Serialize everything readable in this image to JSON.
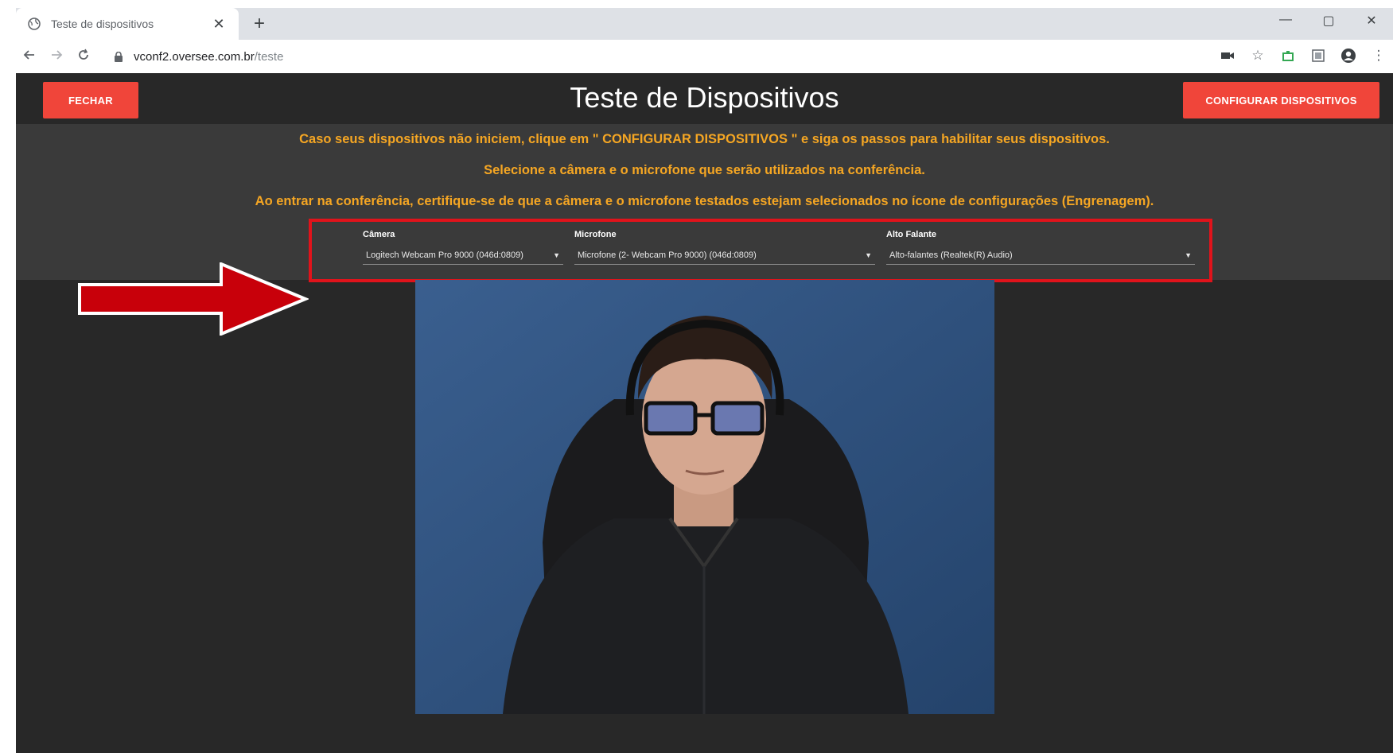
{
  "browser": {
    "tab_title": "Teste de dispositivos",
    "tab_close": "✕",
    "new_tab": "+",
    "url_host": "vconf2.oversee.com.br",
    "url_path": "/teste",
    "window_controls": [
      "—",
      "▢",
      "✕"
    ]
  },
  "app": {
    "title": "Teste de Dispositivos",
    "close_button": "FECHAR",
    "configure_button": "CONFIGURAR DISPOSITIVOS",
    "instructions": [
      "Caso seus dispositivos não iniciem, clique em \" CONFIGURAR DISPOSITIVOS \" e siga os passos para habilitar seus dispositivos.",
      "Selecione a câmera e o microfone que serão utilizados na conferência.",
      "Ao entrar na conferência, certifique-se de que a câmera e o microfone testados estejam selecionados no ícone de configurações (Engrenagem)."
    ],
    "devices": {
      "camera": {
        "label": "Câmera",
        "value": "Logitech Webcam Pro 9000 (046d:0809)"
      },
      "microphone": {
        "label": "Microfone",
        "value": "Microfone (2- Webcam Pro 9000) (046d:0809)"
      },
      "speaker": {
        "label": "Alto Falante",
        "value": "Alto-falantes (Realtek(R) Audio)"
      }
    }
  },
  "colors": {
    "accent_red": "#f0453a",
    "instruction_text": "#f5a623",
    "highlight_box": "#e0131b",
    "background": "#282828"
  },
  "icons": {
    "back": "arrow-left-icon",
    "forward": "arrow-right-icon",
    "reload": "reload-icon",
    "lock": "lock-icon",
    "star": "star-icon",
    "profile": "profile-icon",
    "annotation_arrow": "red-arrow-icon"
  }
}
